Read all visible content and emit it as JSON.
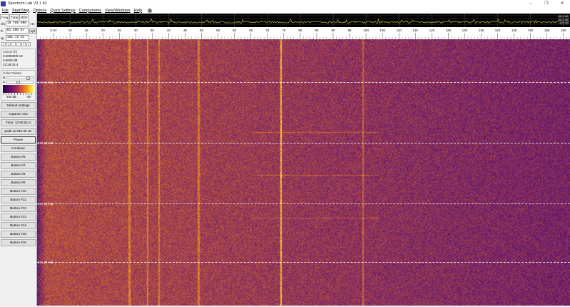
{
  "window": {
    "title": "Spectrum Lab V3.1 b2",
    "min": "–",
    "restore": "❐",
    "close": "✕"
  },
  "menu": [
    "File",
    "Start/Stop",
    "Options",
    "Quick Settings",
    "Components",
    "View/Windows",
    "Help"
  ],
  "left": {
    "tabs": [
      "Freq",
      "Time",
      "RDF"
    ],
    "vfo": {
      "label": "vfo",
      "value": "10 700 000",
      "unit": "Hz"
    },
    "fc": {
      "label": "fc",
      "value": "81.400 Hz",
      "opt": "opt"
    },
    "sp": {
      "label": "sp",
      "value": "161.72 Hz"
    },
    "small_buttons": [
      "<",
      "<",
      "-",
      "-",
      "*",
      ">"
    ],
    "cursor": {
      "title": "Cursor [h]",
      "freq": "0.0000000 Hz",
      "db": "0.0000 dB",
      "time": "23:29:33.4"
    },
    "palette": {
      "title": "Color Palette",
      "b": "B",
      "c": "C",
      "min": "-100 dB",
      "max": "-50",
      "b_level": 0.8,
      "c_level": 0.4
    },
    "buttons": [
      "Default settings",
      "Capture now",
      "Time:  12:55:51.0",
      "peak at 346.36 Hz",
      "Pause",
      "Continue",
      "Button #6",
      "Button #7",
      "Button #8",
      "Button #9",
      "Button #10",
      "Button #11",
      "Button #12",
      "Button #13",
      "Button #14",
      "Button #15",
      "Button #16"
    ]
  },
  "spectrum": {
    "db_labels": [
      "-60.0 dB",
      "-80.0 dB",
      "-100 dB"
    ],
    "trace_color": "#c8c832"
  },
  "axis": {
    "unit_label": "5 Hz",
    "min_hz": 0,
    "max_hz": 162,
    "major_step": 5,
    "labels": [
      "5",
      "10",
      "15",
      "20",
      "25",
      "30",
      "35",
      "40",
      "45",
      "50",
      "55",
      "60",
      "65",
      "70",
      "75",
      "80",
      "85",
      "90",
      "95",
      "100",
      "105",
      "110",
      "115",
      "120",
      "125",
      "130",
      "135",
      "140",
      "145",
      "150",
      "155",
      "160"
    ]
  },
  "waterfall": {
    "time_marks": [
      "23:55:01",
      "23:50:08",
      "23:45:08",
      "23:40:08"
    ],
    "strong_lines_hz": [
      28,
      33.5,
      37,
      49,
      74,
      99
    ],
    "colors": {
      "low": "#4a1060",
      "mid": "#b04a40",
      "high": "#f0a030"
    }
  }
}
